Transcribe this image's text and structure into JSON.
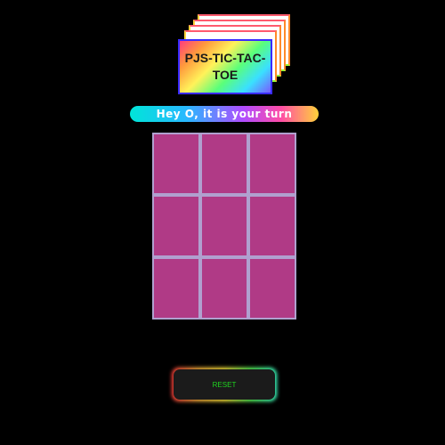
{
  "app": {
    "title": "PJS-TIC-TAC-TOE"
  },
  "status": {
    "message": "Hey O, it is your turn"
  },
  "board": {
    "cells": [
      "",
      "",
      "",
      "",
      "",
      "",
      "",
      "",
      ""
    ]
  },
  "controls": {
    "reset_label": "RESET"
  },
  "colors": {
    "background": "#000000",
    "cell_fill": "#b03a86",
    "cell_border": "#b0a0cf",
    "reset_text": "#1fd41f",
    "reset_bg": "#1b1b1b"
  }
}
